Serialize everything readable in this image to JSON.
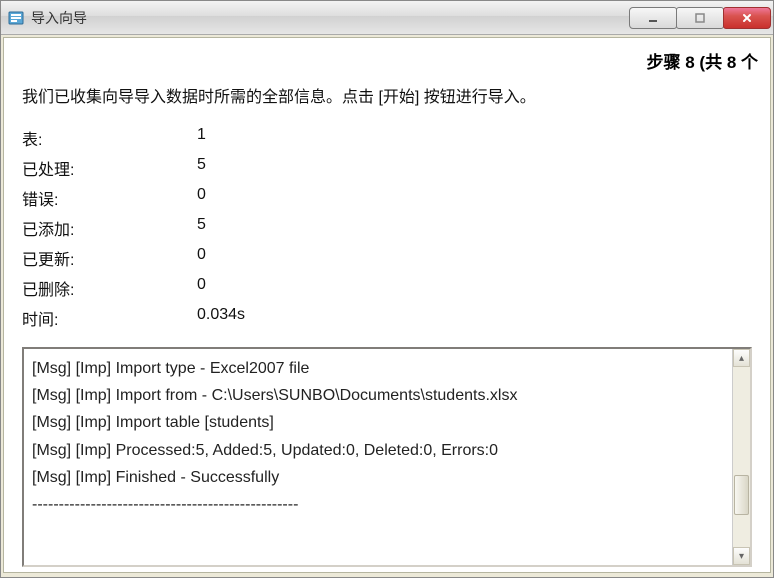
{
  "window": {
    "title": "导入向导"
  },
  "step": {
    "label": "步骤 8 (共 8 个"
  },
  "intro": {
    "text": "我们已收集向导导入数据时所需的全部信息。点击 [开始] 按钮进行导入。"
  },
  "stats": {
    "labels": {
      "tables": "表:",
      "processed": "已处理:",
      "errors": "错误:",
      "added": "已添加:",
      "updated": "已更新:",
      "deleted": "已删除:",
      "time": "时间:"
    },
    "values": {
      "tables": "1",
      "processed": "5",
      "errors": "0",
      "added": "5",
      "updated": "0",
      "deleted": "0",
      "time": "0.034s"
    }
  },
  "log": {
    "lines": [
      "[Msg] [Imp] Import type - Excel2007 file",
      "[Msg] [Imp] Import from - C:\\Users\\SUNBO\\Documents\\students.xlsx",
      "[Msg] [Imp] Import table [students]",
      "[Msg] [Imp] Processed:5, Added:5, Updated:0, Deleted:0, Errors:0",
      "[Msg] [Imp] Finished - Successfully",
      "--------------------------------------------------"
    ]
  }
}
